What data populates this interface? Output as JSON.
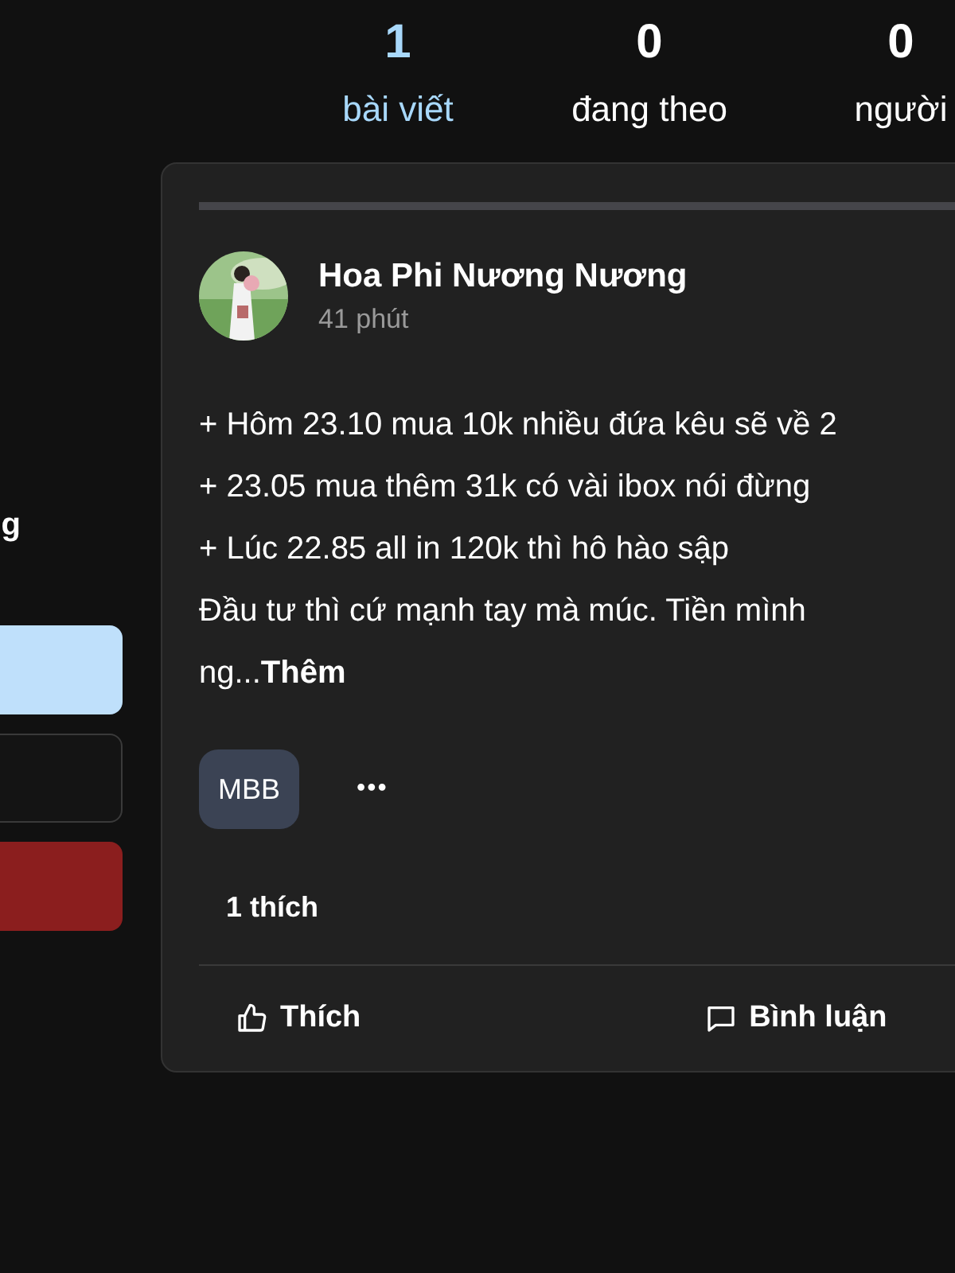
{
  "stats": [
    {
      "value": "1",
      "label": "bài viết",
      "selected": true
    },
    {
      "value": "0",
      "label": "đang theo",
      "selected": false
    },
    {
      "value": "0",
      "label": "người",
      "selected": false
    }
  ],
  "sidebar": {
    "text": "g",
    "buttons": [
      {
        "kind": "primary"
      },
      {
        "kind": "outline"
      },
      {
        "kind": "danger"
      }
    ]
  },
  "post": {
    "author": "Hoa Phi Nương Nương",
    "time": "41 phút",
    "lines": [
      "+ Hôm 23.10 mua 10k nhiều đứa kêu sẽ về 2",
      "+ 23.05 mua thêm 31k có vài ibox nói đừng",
      "+ Lúc 22.85 all in 120k thì hô hào sập",
      "Đầu tư thì cứ mạnh tay mà múc. Tiền mình",
      "ng...**Thêm**"
    ],
    "tags": [
      "MBB"
    ],
    "more": "•••",
    "likes": "1 thích",
    "actions": [
      {
        "kind": "like",
        "label": "Thích"
      },
      {
        "kind": "comment",
        "label": "Bình luận"
      }
    ]
  }
}
